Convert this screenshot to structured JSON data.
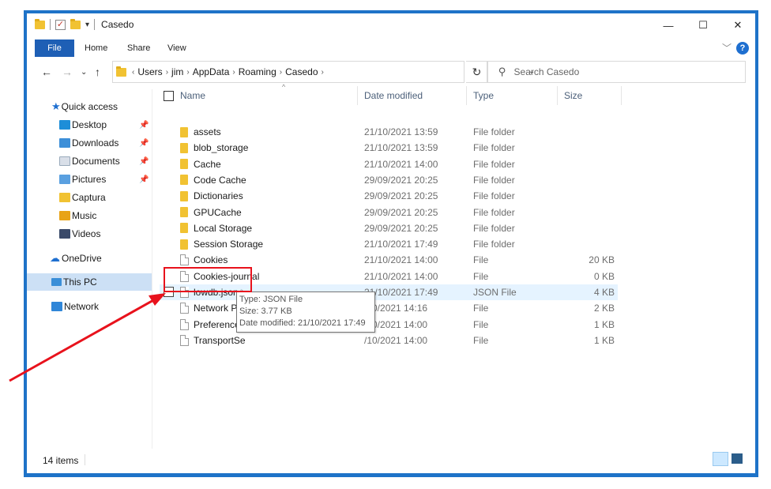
{
  "window": {
    "title": "Casedo"
  },
  "window_controls": {
    "minimize": "—",
    "maximize": "☐",
    "close": "✕"
  },
  "ribbon": {
    "file": "File",
    "home": "Home",
    "share": "Share",
    "view": "View"
  },
  "address": {
    "crumbs": [
      "Users",
      "jim",
      "AppData",
      "Roaming",
      "Casedo"
    ]
  },
  "search": {
    "placeholder": "Search Casedo"
  },
  "nav": {
    "items": [
      {
        "label": "Quick access"
      },
      {
        "label": "Desktop"
      },
      {
        "label": "Downloads"
      },
      {
        "label": "Documents"
      },
      {
        "label": "Pictures"
      },
      {
        "label": "Captura"
      },
      {
        "label": "Music"
      },
      {
        "label": "Videos"
      },
      {
        "label": "OneDrive"
      },
      {
        "label": "This PC"
      },
      {
        "label": "Network"
      }
    ]
  },
  "columns": {
    "name": "Name",
    "date": "Date modified",
    "type": "Type",
    "size": "Size"
  },
  "files": [
    {
      "name": "assets",
      "date": "21/10/2021 13:59",
      "type": "File folder",
      "size": ""
    },
    {
      "name": "blob_storage",
      "date": "21/10/2021 13:59",
      "type": "File folder",
      "size": ""
    },
    {
      "name": "Cache",
      "date": "21/10/2021 14:00",
      "type": "File folder",
      "size": ""
    },
    {
      "name": "Code Cache",
      "date": "29/09/2021 20:25",
      "type": "File folder",
      "size": ""
    },
    {
      "name": "Dictionaries",
      "date": "29/09/2021 20:25",
      "type": "File folder",
      "size": ""
    },
    {
      "name": "GPUCache",
      "date": "29/09/2021 20:25",
      "type": "File folder",
      "size": ""
    },
    {
      "name": "Local Storage",
      "date": "29/09/2021 20:25",
      "type": "File folder",
      "size": ""
    },
    {
      "name": "Session Storage",
      "date": "21/10/2021 17:49",
      "type": "File folder",
      "size": ""
    },
    {
      "name": "Cookies",
      "date": "21/10/2021 14:00",
      "type": "File",
      "size": "20 KB"
    },
    {
      "name": "Cookies-journal",
      "date": "21/10/2021 14:00",
      "type": "File",
      "size": "0 KB"
    },
    {
      "name": "lowdb.json",
      "date": "21/10/2021 17:49",
      "type": "JSON File",
      "size": "4 KB"
    },
    {
      "name": "Network Pe",
      "date": "/10/2021 14:16",
      "type": "File",
      "size": "2 KB"
    },
    {
      "name": "Preferences",
      "date": "/10/2021 14:00",
      "type": "File",
      "size": "1 KB"
    },
    {
      "name": "TransportSe",
      "date": "/10/2021 14:00",
      "type": "File",
      "size": "1 KB"
    }
  ],
  "tooltip": {
    "type": "Type: JSON File",
    "size": "Size: 3.77 KB",
    "modified": "Date modified: 21/10/2021 17:49"
  },
  "status": {
    "count": "14 items"
  },
  "colors": {
    "accent": "#1e5fb5",
    "highlight": "#e8121c",
    "hover_row": "#e5f3ff",
    "selected_nav": "#cce0f5"
  }
}
